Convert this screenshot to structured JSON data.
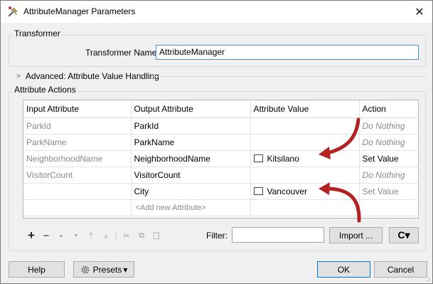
{
  "window": {
    "title": "AttributeManager Parameters",
    "close_glyph": "✕",
    "title_icon": "tools-icon"
  },
  "transformer": {
    "group_label": "Transformer",
    "name_label": "Transformer Name:",
    "name_value": "AttributeManager"
  },
  "advanced": {
    "label": "Advanced: Attribute Value Handling"
  },
  "actions": {
    "group_label": "Attribute Actions",
    "columns": [
      "Input Attribute",
      "Output Attribute",
      "Attribute Value",
      "Action"
    ],
    "rows": [
      {
        "input": "ParkId",
        "output": "ParkId",
        "value": "",
        "action": "Do Nothing"
      },
      {
        "input": "ParkName",
        "output": "ParkName",
        "value": "",
        "action": "Do Nothing"
      },
      {
        "input": "NeighborhoodName",
        "output": "NeighborhoodName",
        "value": "Kitsilano",
        "action": "Set Value"
      },
      {
        "input": "VisitorCount",
        "output": "VisitorCount",
        "value": "",
        "action": "Do Nothing"
      },
      {
        "input": "",
        "output": "City",
        "value": "Vancouver",
        "action": "Set Value"
      }
    ],
    "add_row_label": "<Add new Attribute>"
  },
  "toolbar": {
    "add": "+",
    "remove": "−",
    "move_up": "▲",
    "move_down": "▼",
    "move_top": "⤒",
    "move_bottom": "⤓",
    "cut": "✂",
    "copy": "⧉",
    "paste": "📋",
    "filter_label": "Filter:",
    "filter_value": "",
    "import_label": "Import ...",
    "refresh_glyph": "C▾"
  },
  "footer": {
    "help_label": "Help",
    "presets_label": "Presets",
    "presets_arrow": "▾",
    "ok_label": "OK",
    "cancel_label": "Cancel"
  },
  "colors": {
    "arrow": "#b22222",
    "focus_border": "#4a90d9",
    "ok_border": "#0078d7"
  }
}
